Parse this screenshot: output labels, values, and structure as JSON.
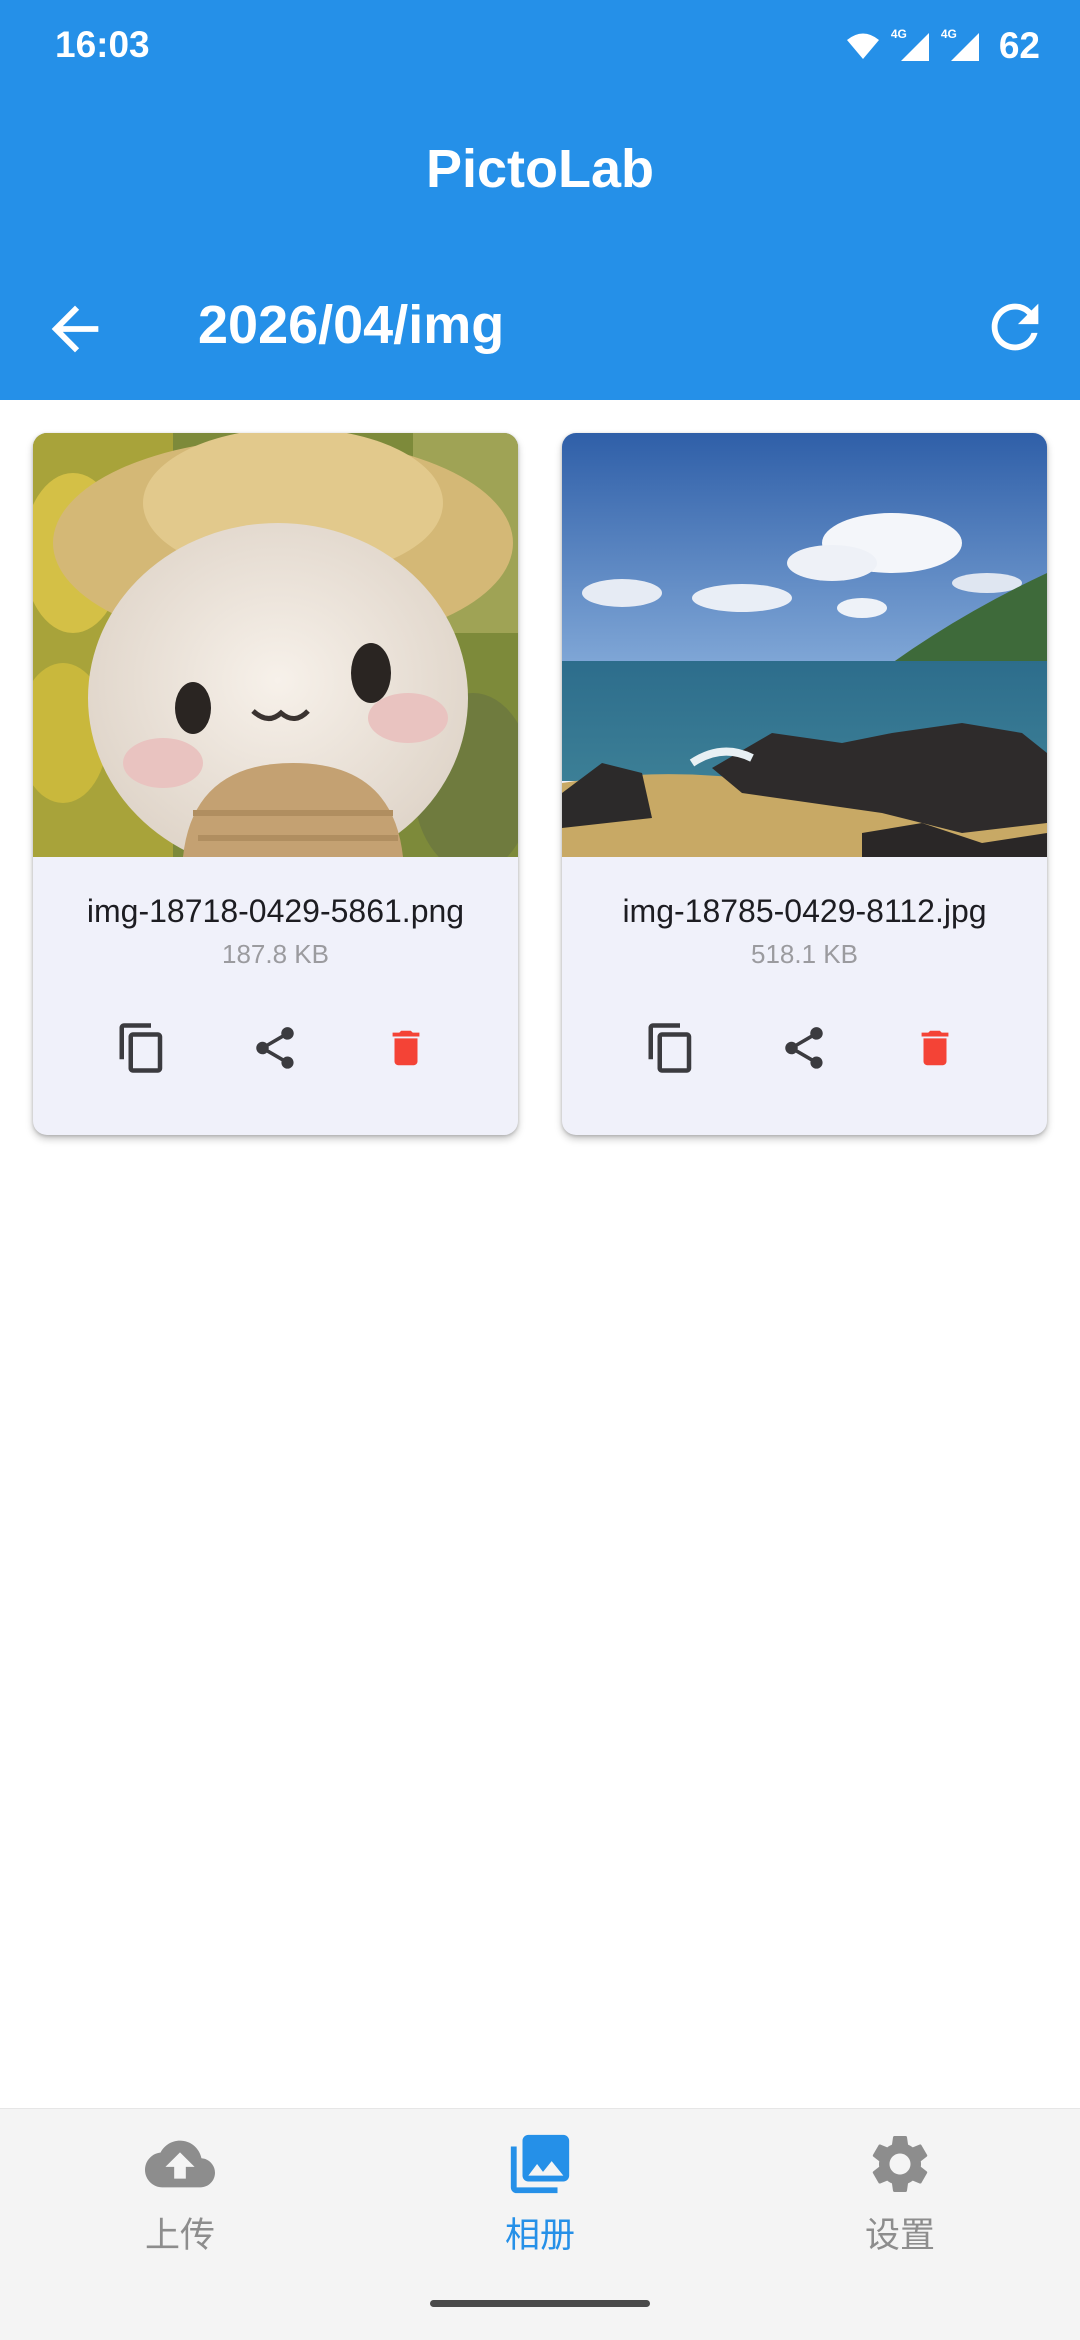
{
  "status_bar": {
    "time": "16:03",
    "network_1": "4G",
    "network_2": "4G",
    "battery": "62"
  },
  "app_bar": {
    "title": "PictoLab",
    "path": "2026/04/img",
    "back_icon": "arrow-left-icon",
    "refresh_icon": "refresh-icon"
  },
  "images": [
    {
      "name": "img-18718-0429-5861.png",
      "size": "187.8 KB",
      "thumb": "plush-doll-photo"
    },
    {
      "name": "img-18785-0429-8112.jpg",
      "size": "518.1 KB",
      "thumb": "seaside-rocks-photo"
    }
  ],
  "card_actions": {
    "copy_icon": "copy-icon",
    "share_icon": "share-icon",
    "delete_icon": "trash-icon"
  },
  "bottom_nav": {
    "items": [
      {
        "label": "上传",
        "icon": "cloud-upload-icon",
        "active": false
      },
      {
        "label": "相册",
        "icon": "photo-library-icon",
        "active": true
      },
      {
        "label": "设置",
        "icon": "gear-icon",
        "active": false
      }
    ]
  },
  "colors": {
    "primary": "#2590E8",
    "delete": "#F44336",
    "card_bg": "#F0F1FA",
    "nav_inactive": "#8d8d8d"
  }
}
